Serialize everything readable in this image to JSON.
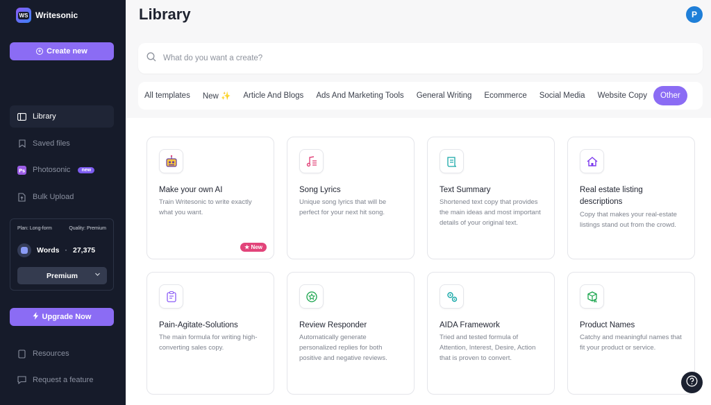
{
  "app": {
    "name": "Writesonic",
    "logo_mark": "WS"
  },
  "sidebar": {
    "create_label": "Create new",
    "nav_top": [
      {
        "label": "Library",
        "icon": "library-icon",
        "active": true
      },
      {
        "label": "Saved files",
        "icon": "bookmark-icon",
        "active": false
      },
      {
        "label": "Photosonic",
        "icon": "photosonic-icon",
        "active": false,
        "badge": "new"
      },
      {
        "label": "Bulk Upload",
        "icon": "file-upload-icon",
        "active": false
      }
    ],
    "plan": {
      "plan_text": "Plan: Long-form",
      "quality_text": "Quality: Premium",
      "words_label": "Words",
      "words_count": "27,375",
      "selected_quality": "Premium"
    },
    "upgrade_label": "Upgrade Now",
    "nav_bottom": [
      {
        "label": "Resources",
        "icon": "book-icon"
      },
      {
        "label": "Request a feature",
        "icon": "message-icon"
      }
    ]
  },
  "header": {
    "title": "Library",
    "avatar_initial": "P"
  },
  "search": {
    "placeholder": "What do you want a create?"
  },
  "tabs": [
    {
      "label": "All templates",
      "active": false
    },
    {
      "label": "New ✨",
      "active": false
    },
    {
      "label": "Article And Blogs",
      "active": false
    },
    {
      "label": "Ads And Marketing Tools",
      "active": false
    },
    {
      "label": "General Writing",
      "active": false
    },
    {
      "label": "Ecommerce",
      "active": false
    },
    {
      "label": "Social Media",
      "active": false
    },
    {
      "label": "Website Copy",
      "active": false
    },
    {
      "label": "Other",
      "active": true
    }
  ],
  "cards": [
    {
      "title": "Make your own AI",
      "desc": "Train Writesonic to write exactly what you want.",
      "icon": "robot-icon",
      "badge": "★ New"
    },
    {
      "title": "Song Lyrics",
      "desc": "Unique song lyrics that will be perfect for your next hit song.",
      "icon": "music-note-icon"
    },
    {
      "title": "Text Summary",
      "desc": "Shortened text copy that provides the main ideas and most important details of your original text.",
      "icon": "scroll-icon"
    },
    {
      "title": "Real estate listing descriptions",
      "desc": "Copy that makes your real-estate listings stand out from the crowd.",
      "icon": "house-icon"
    },
    {
      "title": "Pain-Agitate-Solutions",
      "desc": "The main formula for writing high-converting sales copy.",
      "icon": "clipboard-icon"
    },
    {
      "title": "Review Responder",
      "desc": "Automatically generate personalized replies for both positive and negative reviews.",
      "icon": "star-badge-icon"
    },
    {
      "title": "AIDA Framework",
      "desc": "Tried and tested formula of Attention, Interest, Desire, Action that is proven to convert.",
      "icon": "gears-icon"
    },
    {
      "title": "Product Names",
      "desc": "Catchy and meaningful names that fit your product or service.",
      "icon": "box-icon"
    }
  ],
  "colors": {
    "accent": "#8b6cf4",
    "sidebar_bg": "#161b2a",
    "new_badge": "#e2447a",
    "avatar": "#1f7fd8"
  }
}
